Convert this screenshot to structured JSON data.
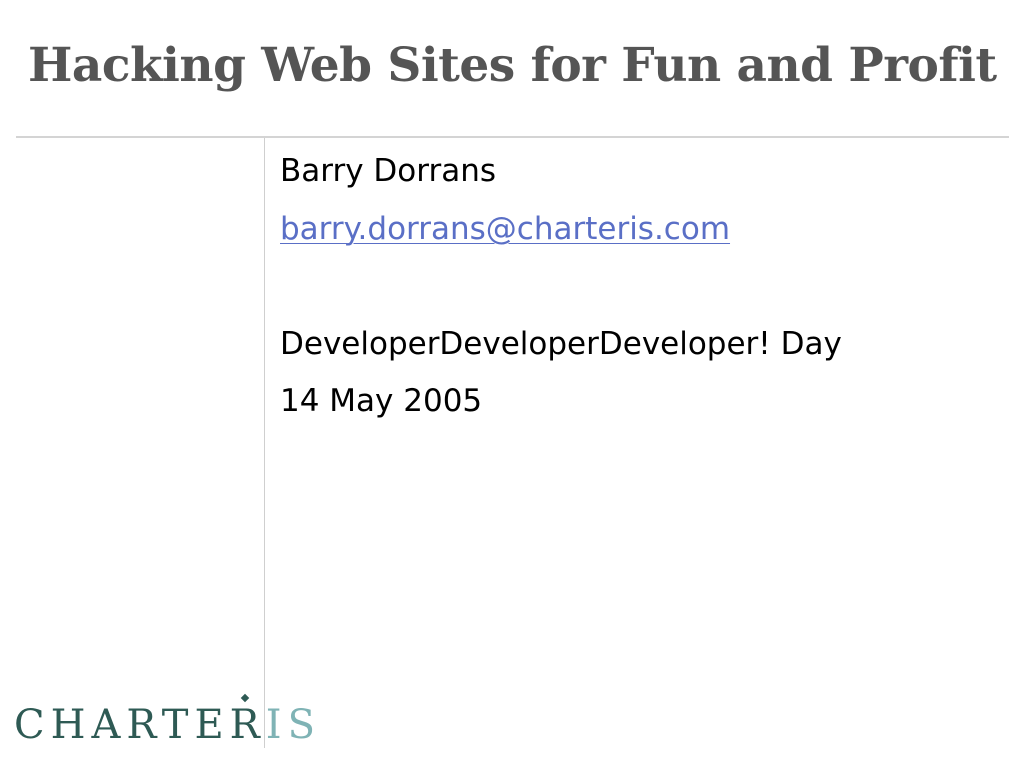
{
  "slide": {
    "title": "Hacking Web Sites for Fun and Profit",
    "author": "Barry Dorrans",
    "email": "barry.dorrans@charteris.com",
    "event": "DeveloperDeveloperDeveloper! Day",
    "date": "14 May 2005"
  },
  "logo": {
    "text_main": "CHARTER",
    "text_accent": "IS",
    "brand_color": "#2e5a54",
    "accent_color": "#7fb3b5"
  },
  "colors": {
    "title": "#555555",
    "link": "#5a6fc6",
    "rule": "#d4d4d4"
  }
}
